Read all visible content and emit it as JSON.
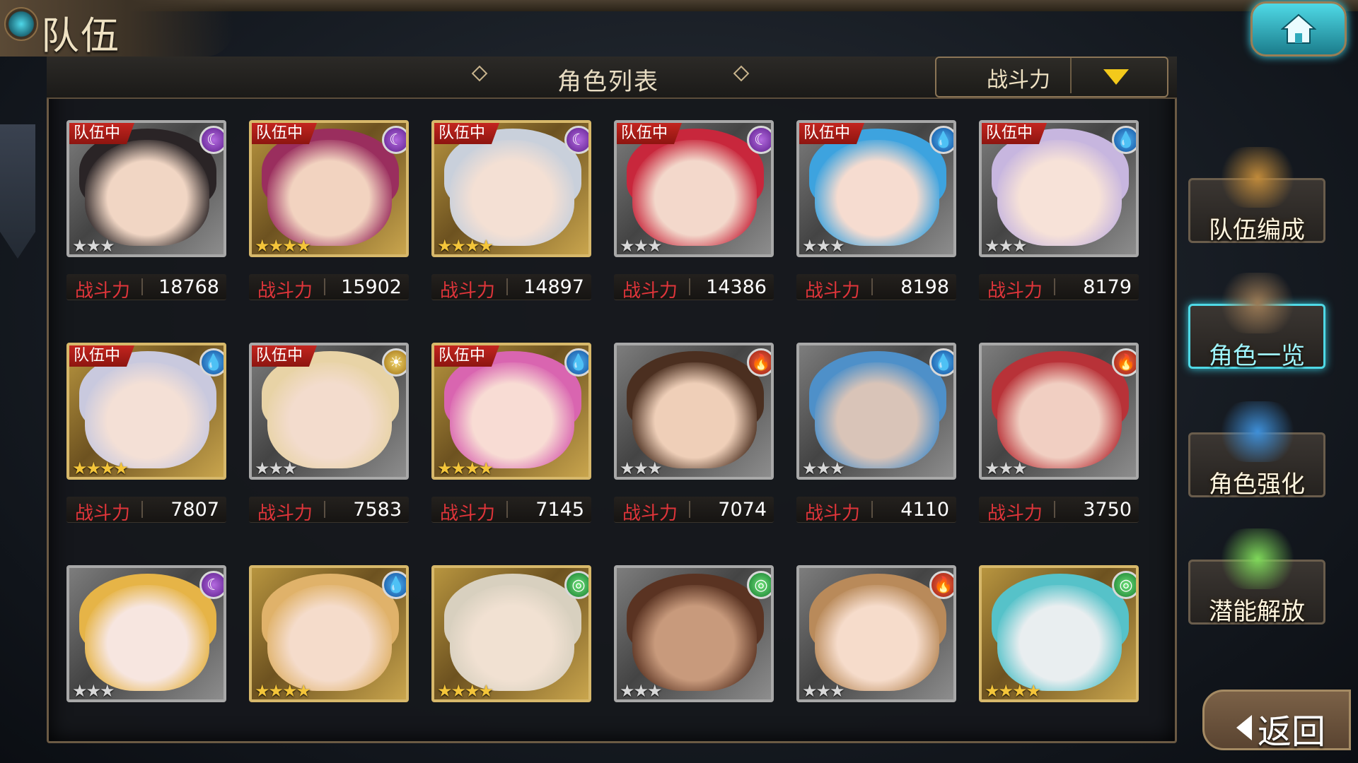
{
  "header": {
    "title": "队伍",
    "home_icon": "home-icon"
  },
  "list": {
    "title": "角色列表",
    "sort": {
      "selected": "战斗力",
      "arrow_icon": "dropdown-arrow-icon"
    },
    "power_label": "战斗力",
    "team_tag": "队伍中",
    "cards": [
      {
        "in_team": true,
        "element": "moon",
        "frame": "silver",
        "stars": 3,
        "power": "18768",
        "hair": "#2a2426",
        "skin": "#f1d6c4"
      },
      {
        "in_team": true,
        "element": "moon",
        "frame": "gold",
        "stars": 4,
        "power": "15902",
        "hair": "#9a2e5e",
        "skin": "#f2d3c0"
      },
      {
        "in_team": true,
        "element": "moon",
        "frame": "gold",
        "stars": 4,
        "power": "14897",
        "hair": "#c9d0db",
        "skin": "#f4e0d4"
      },
      {
        "in_team": true,
        "element": "moon",
        "frame": "silver",
        "stars": 3,
        "power": "14386",
        "hair": "#c8273c",
        "skin": "#f3d8cb"
      },
      {
        "in_team": true,
        "element": "water",
        "frame": "silver",
        "stars": 3,
        "power": "8198",
        "hair": "#3da3df",
        "skin": "#f6dcd0"
      },
      {
        "in_team": true,
        "element": "water",
        "frame": "silver",
        "stars": 3,
        "power": "8179",
        "hair": "#c7b6df",
        "skin": "#f7e2d8"
      },
      {
        "in_team": true,
        "element": "water",
        "frame": "gold",
        "stars": 4,
        "power": "7807",
        "hair": "#c9c9de",
        "skin": "#f4e0d6"
      },
      {
        "in_team": true,
        "element": "sun",
        "frame": "silver",
        "stars": 3,
        "power": "7583",
        "hair": "#e8d3a6",
        "skin": "#f3dccd"
      },
      {
        "in_team": true,
        "element": "water",
        "frame": "gold",
        "stars": 4,
        "power": "7145",
        "hair": "#d965b0",
        "skin": "#f8dcd4"
      },
      {
        "in_team": false,
        "element": "fire",
        "frame": "silver",
        "stars": 3,
        "power": "7074",
        "hair": "#4b2f20",
        "skin": "#efcfb8"
      },
      {
        "in_team": false,
        "element": "water",
        "frame": "silver",
        "stars": 3,
        "power": "4110",
        "hair": "#4e90c9",
        "skin": "#d9c4b8"
      },
      {
        "in_team": false,
        "element": "fire",
        "frame": "silver",
        "stars": 3,
        "power": "3750",
        "hair": "#b83238",
        "skin": "#f1cfc2"
      },
      {
        "in_team": false,
        "element": "moon",
        "frame": "silver",
        "stars": 3,
        "power": "",
        "hair": "#e6b447",
        "skin": "#f7e6e0"
      },
      {
        "in_team": false,
        "element": "water",
        "frame": "gold",
        "stars": 4,
        "power": "",
        "hair": "#e0b26a",
        "skin": "#f5dccb"
      },
      {
        "in_team": false,
        "element": "wind",
        "frame": "gold",
        "stars": 4,
        "power": "",
        "hair": "#d8d0bf",
        "skin": "#f1e1d2"
      },
      {
        "in_team": false,
        "element": "wind",
        "frame": "silver",
        "stars": 3,
        "power": "",
        "hair": "#5a3322",
        "skin": "#c89a7c"
      },
      {
        "in_team": false,
        "element": "fire",
        "frame": "silver",
        "stars": 3,
        "power": "",
        "hair": "#b98a5a",
        "skin": "#f6dccb"
      },
      {
        "in_team": false,
        "element": "wind",
        "frame": "gold",
        "stars": 4,
        "power": "",
        "hair": "#56c2c9",
        "skin": "#e9eef0"
      }
    ]
  },
  "side_menu": [
    {
      "label": "队伍编成",
      "active": false,
      "art_color": "#c08a3a"
    },
    {
      "label": "角色一览",
      "active": true,
      "art_color": "#9b7a55"
    },
    {
      "label": "角色强化",
      "active": false,
      "art_color": "#3e8fd8"
    },
    {
      "label": "潜能解放",
      "active": false,
      "art_color": "#7fd85a"
    }
  ],
  "back": {
    "label": "返回",
    "arrow_icon": "back-arrow-icon"
  },
  "colors": {
    "accent_cyan": "#4fd9e6",
    "power_red": "#e0353a",
    "gold_star": "#f4c53a",
    "team_tag_red": "#c3251f"
  }
}
